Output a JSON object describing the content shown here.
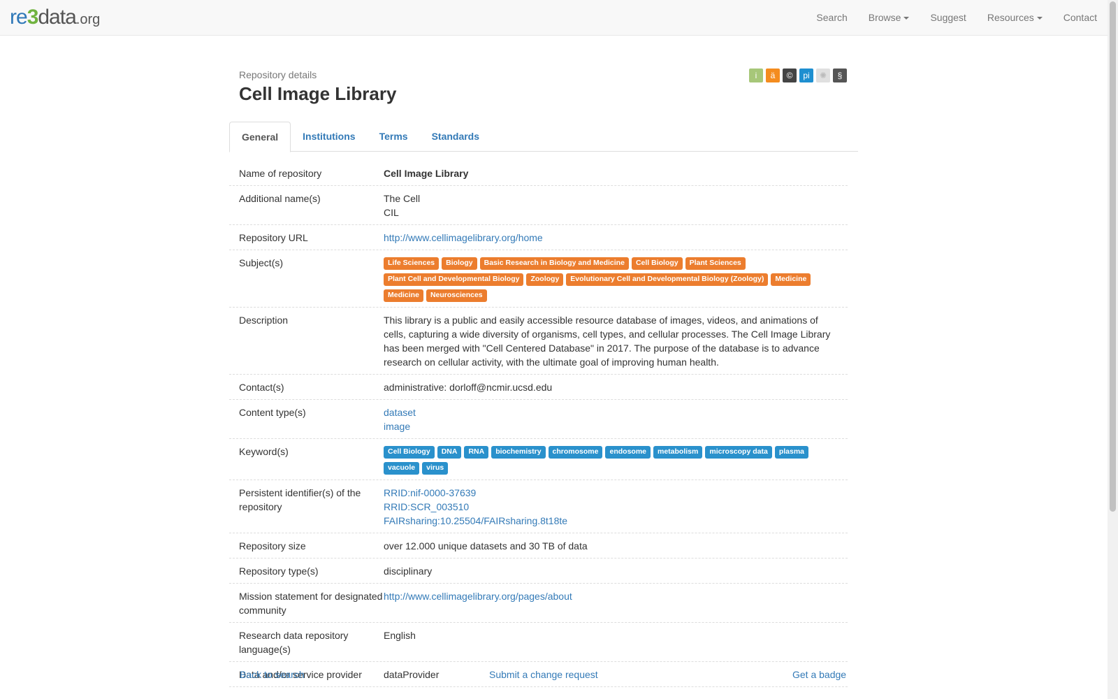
{
  "brand": {
    "re": "re",
    "three": "3",
    "data": "data",
    "org": ".org"
  },
  "nav": [
    {
      "label": "Search"
    },
    {
      "label": "Browse",
      "dropdown": true
    },
    {
      "label": "Suggest"
    },
    {
      "label": "Resources",
      "dropdown": true
    },
    {
      "label": "Contact"
    }
  ],
  "header": {
    "subtitle": "Repository details",
    "title": "Cell Image Library"
  },
  "badge_icons": [
    {
      "icon": "info-icon",
      "glyph": "i",
      "color": "#a7c779"
    },
    {
      "icon": "open-access-icon",
      "glyph": "ä",
      "color": "#f48c1f"
    },
    {
      "icon": "copyright-icon",
      "glyph": "©",
      "color": "#444444"
    },
    {
      "icon": "pid-icon",
      "glyph": "pi",
      "color": "#1e8fd0"
    },
    {
      "icon": "certificate-icon",
      "glyph": "✺",
      "color": "#e0e0e0"
    },
    {
      "icon": "policy-icon",
      "glyph": "§",
      "color": "#555555"
    }
  ],
  "tabs": [
    "General",
    "Institutions",
    "Terms",
    "Standards"
  ],
  "details": {
    "name": {
      "label": "Name of repository",
      "value": "Cell Image Library"
    },
    "additional": {
      "label": "Additional name(s)",
      "values": [
        "The Cell",
        "CIL"
      ]
    },
    "url": {
      "label": "Repository URL",
      "value": "http://www.cellimagelibrary.org/home"
    },
    "subjects": {
      "label": "Subject(s)",
      "tags": [
        "Life Sciences",
        "Biology",
        "Basic Research in Biology and Medicine",
        "Cell Biology",
        "Plant Sciences",
        "Plant Cell and Developmental Biology",
        "Zoology",
        "Evolutionary Cell and Developmental Biology (Zoology)",
        "Medicine",
        "Medicine",
        "Neurosciences"
      ]
    },
    "description": {
      "label": "Description",
      "value": "This library is a public and easily accessible resource database of images, videos, and animations of cells, capturing a wide diversity of organisms, cell types, and cellular processes. The Cell Image Library has been merged with \"Cell Centered Database\" in 2017. The purpose of the database is to advance research on cellular activity, with the ultimate goal of improving human health."
    },
    "contacts": {
      "label": "Contact(s)",
      "value": "administrative: dorloff@ncmir.ucsd.edu"
    },
    "content_types": {
      "label": "Content type(s)",
      "values": [
        "dataset",
        "image"
      ]
    },
    "keywords": {
      "label": "Keyword(s)",
      "tags": [
        "Cell Biology",
        "DNA",
        "RNA",
        "biochemistry",
        "chromosome",
        "endosome",
        "metabolism",
        "microscopy data",
        "plasma",
        "vacuole",
        "virus"
      ]
    },
    "pids": {
      "label": "Persistent identifier(s) of the repository",
      "values": [
        "RRID:nif-0000-37639",
        "RRID:SCR_003510",
        "FAIRsharing:10.25504/FAIRsharing.8t18te"
      ]
    },
    "size": {
      "label": "Repository size",
      "value": "over 12.000 unique datasets and 30 TB of data"
    },
    "type": {
      "label": "Repository type(s)",
      "value": "disciplinary"
    },
    "mission": {
      "label": "Mission statement for designated community",
      "value": "http://www.cellimagelibrary.org/pages/about"
    },
    "language": {
      "label": "Research data repository language(s)",
      "value": "English"
    },
    "provider": {
      "label": "Data and/or service provider",
      "value": "dataProvider"
    }
  },
  "footer": {
    "back": "Back to search",
    "change": "Submit a change request",
    "badge": "Get a badge"
  }
}
